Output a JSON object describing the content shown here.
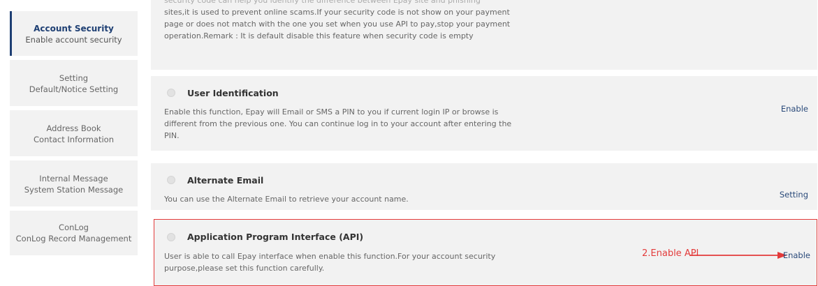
{
  "sidebar": {
    "items": [
      {
        "title": "Account Security",
        "subtitle": "Enable account security",
        "active": true
      },
      {
        "title": "Setting",
        "subtitle": "Default/Notice Setting",
        "active": false
      },
      {
        "title": "Address Book",
        "subtitle": "Contact Information",
        "active": false
      },
      {
        "title": "Internal Message",
        "subtitle": "System Station Message",
        "active": false
      },
      {
        "title": "ConLog",
        "subtitle": "ConLog Record Management",
        "active": false
      }
    ]
  },
  "security_code_panel": {
    "description": "security code can help you identify the difference between Epay site and phishing sites,it is used to prevent online scams.If your security code is not show on your payment page or does not match with the one you set when you use API to pay,stop your payment operation.Remark : It is default disable this feature when security code is empty",
    "faded_line": "security code can help you identify the difference between Epay site and phishing",
    "body": "sites,it is used to prevent online scams.If your security code is not show on your payment page or does not match with the one you set when you use API to pay,stop your payment operation.Remark : It is default disable this feature when security code is empty"
  },
  "panels": [
    {
      "title": "User Identification",
      "description": "Enable this function, Epay will Email or SMS a PIN to you if current login IP or browse is different from the previous one. You can continue log in to your account after entering the PIN.",
      "action": "Enable"
    },
    {
      "title": "Alternate Email",
      "description": "You can use the Alternate Email to retrieve your account name.",
      "action": "Setting"
    },
    {
      "title": "Application Program Interface (API)",
      "description": "User is able to call Epay interface when enable this function.For your account security purpose,please set this function carefully.",
      "action": "Enable"
    }
  ],
  "annotation": {
    "text": "2.Enable API",
    "color": "#e33b3b"
  },
  "colors": {
    "accent": "#1e3f73",
    "panel_bg": "#f2f2f2",
    "highlight_border": "#e33b3b",
    "link": "#2a4a7a"
  }
}
